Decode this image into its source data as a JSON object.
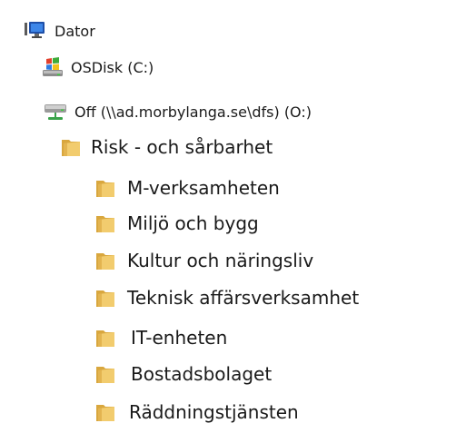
{
  "tree": {
    "computer": {
      "label": "Dator",
      "icon": "computer-icon"
    },
    "drives": [
      {
        "label": "OSDisk (C:)",
        "icon": "windows-drive-icon"
      },
      {
        "label": "Off (\\\\ad.morbylanga.se\\dfs) (O:)",
        "icon": "network-drive-icon"
      }
    ],
    "folder": {
      "label": "Risk - och sårbarhet",
      "icon": "folder-icon",
      "children": [
        {
          "label": "M-verksamheten",
          "icon": "folder-icon"
        },
        {
          "label": "Miljö och bygg",
          "icon": "folder-icon"
        },
        {
          "label": "Kultur och näringsliv",
          "icon": "folder-icon"
        },
        {
          "label": "Teknisk affärsverksamhet",
          "icon": "folder-icon"
        },
        {
          "label": "IT-enheten",
          "icon": "folder-icon"
        },
        {
          "label": "Bostadsbolaget",
          "icon": "folder-icon"
        },
        {
          "label": "Räddningstjänsten",
          "icon": "folder-icon"
        }
      ]
    }
  },
  "colors": {
    "folder_fill": "#f2cc6e",
    "folder_dark": "#d9a73e",
    "text": "#1a1a1a",
    "monitor_blue": "#2f6fd6",
    "network_green": "#3aa34a"
  }
}
